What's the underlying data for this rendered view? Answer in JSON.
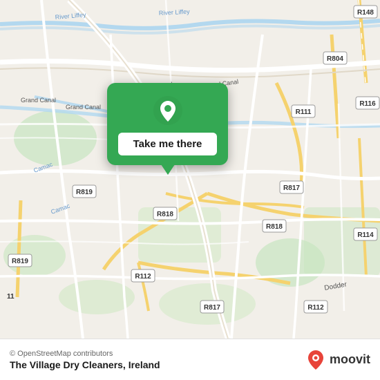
{
  "map": {
    "attribution": "© OpenStreetMap contributors",
    "location_name": "The Village Dry Cleaners, Ireland",
    "popup": {
      "button_label": "Take me there"
    },
    "accent_color": "#34a853"
  },
  "moovit": {
    "logo_text": "moovit"
  }
}
